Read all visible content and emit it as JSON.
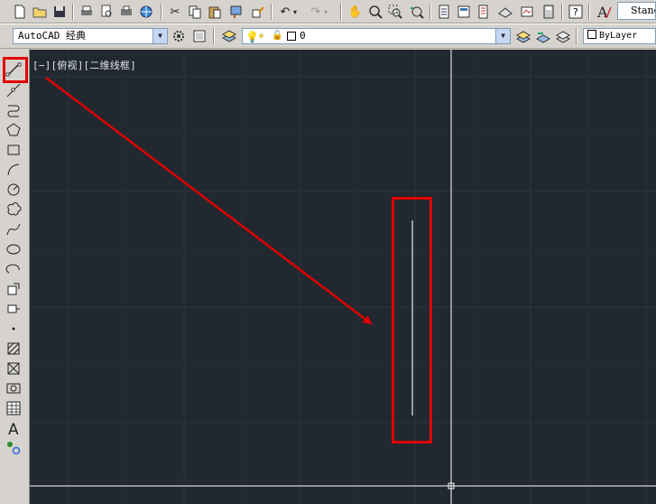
{
  "toolbar_standard": {
    "icons": [
      "new-icon",
      "open-icon",
      "save-icon",
      "print-icon",
      "print-preview-icon",
      "publish-icon",
      "3d-publish-icon",
      "cut-icon",
      "copy-icon",
      "paste-icon",
      "match-properties-icon",
      "block-editor-icon",
      "undo-icon",
      "redo-icon",
      "pan-icon",
      "zoom-realtime-icon",
      "zoom-window-icon",
      "zoom-previous-icon",
      "properties-icon",
      "design-center-icon",
      "tool-palettes-icon",
      "sheet-set-icon",
      "markup-icon",
      "calculator-icon",
      "help-icon",
      "text-style-icon"
    ],
    "text_style_value": "Standard"
  },
  "workspace": {
    "value": "AutoCAD 经典"
  },
  "layer": {
    "value": "0"
  },
  "color_control": {
    "value": "ByLayer"
  },
  "viewport": {
    "label": "[−][俯视][二维线框]"
  },
  "draw_toolbar": {
    "tools": [
      "line",
      "construction-line",
      "polyline",
      "polygon",
      "rectangle",
      "arc",
      "circle",
      "revision-cloud",
      "spline",
      "ellipse",
      "ellipse-arc",
      "insert-block",
      "make-block",
      "point",
      "hatch",
      "gradient",
      "region",
      "table",
      "multiline-text",
      "add-selected"
    ],
    "highlighted": "line"
  },
  "colors": {
    "canvas": "#212830",
    "highlight": "#e00000",
    "crosshair": "#ffffff"
  }
}
